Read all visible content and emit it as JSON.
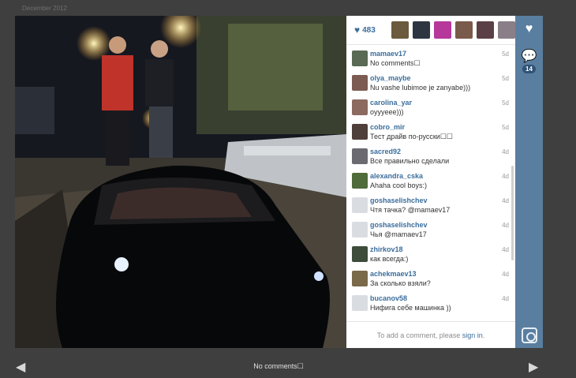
{
  "header": {
    "date": "December 2012"
  },
  "likes": {
    "count": "483",
    "icon": "heart-icon"
  },
  "liker_colors": [
    "#6b5a3e",
    "#2c3540",
    "#b5389a",
    "#7a5a4a",
    "#5b3f46",
    "#8a7f88"
  ],
  "comments": [
    {
      "user": "mamaev17",
      "text": "No comments☐",
      "time": "5d",
      "color": "#5a6a55"
    },
    {
      "user": "olya_maybe",
      "text": "Nu vashe lubimoe je zanyabe)))",
      "time": "5d",
      "color": "#7b5b52"
    },
    {
      "user": "carolina_yar",
      "text": "oyyyeee)))",
      "time": "5d",
      "color": "#8c6a60"
    },
    {
      "user": "cobro_mir",
      "text": "Тест драйв по-русски☐☐",
      "time": "5d",
      "color": "#4e3f3a"
    },
    {
      "user": "sacred92",
      "text": "Все правильно сделали",
      "time": "4d",
      "color": "#6a6a70"
    },
    {
      "user": "alexandra_cska",
      "text": "Ahaha cool boys:)",
      "time": "4d",
      "color": "#4f6b3a"
    },
    {
      "user": "goshaselishchev",
      "text": "Чтя тачка? @mamaev17",
      "time": "4d",
      "color": "#d9dde2"
    },
    {
      "user": "goshaselishchev",
      "text": "Чья @mamaev17",
      "time": "4d",
      "color": "#d9dde2"
    },
    {
      "user": "zhirkov18",
      "text": "как всегда:)",
      "time": "4d",
      "color": "#3e4c3b"
    },
    {
      "user": "achekmaev13",
      "text": "За сколько взяли?",
      "time": "4d",
      "color": "#7a6a4a"
    },
    {
      "user": "bucanov58",
      "text": "Нифига себе машинка ))",
      "time": "4d",
      "color": "#d9dde2"
    }
  ],
  "add_comment": {
    "prefix": "To add a comment, please",
    "link": "sign in",
    "suffix": "."
  },
  "sidebar": {
    "comment_count": "14",
    "like_icon": "heart-icon",
    "comment_icon": "speech-bubble-icon",
    "camera_icon": "instagram-camera-icon"
  },
  "footer": {
    "caption": "No comments☐"
  },
  "colors": {
    "link_blue": "#3b6e9c",
    "sidebar": "#5a7ea0",
    "background": "#3f3f3f"
  }
}
